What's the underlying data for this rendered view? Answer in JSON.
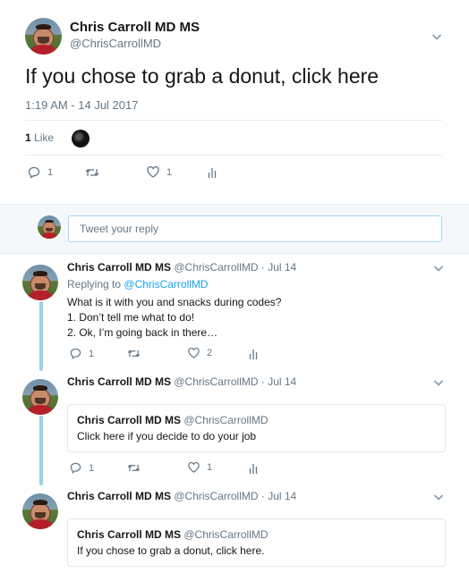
{
  "main_tweet": {
    "display_name": "Chris Carroll MD MS",
    "handle": "@ChrisCarrollMD",
    "text": "If you chose to grab a donut, click here",
    "timestamp": "1:19 AM - 14 Jul 2017",
    "like_count": "1",
    "like_label": "Like",
    "actions": {
      "replies": "1",
      "retweets": "",
      "likes": "1"
    }
  },
  "composer": {
    "placeholder": "Tweet your reply"
  },
  "replies": [
    {
      "display_name": "Chris Carroll MD MS",
      "handle_date": "@ChrisCarrollMD · Jul 14",
      "replying_prefix": "Replying to",
      "replying_to": "@ChrisCarrollMD",
      "lines": [
        "What is it with you and snacks during codes?",
        "1. Don’t tell me what to do!",
        "2. Ok, I’m going back in there…"
      ],
      "actions": {
        "replies": "1",
        "retweets": "",
        "likes": "2"
      }
    },
    {
      "display_name": "Chris Carroll MD MS",
      "handle_date": "@ChrisCarrollMD · Jul 14",
      "quote": {
        "display_name": "Chris Carroll MD MS",
        "handle": "@ChrisCarrollMD",
        "text": "Click here if you decide to do your job"
      },
      "actions": {
        "replies": "1",
        "retweets": "",
        "likes": "1"
      }
    },
    {
      "display_name": "Chris Carroll MD MS",
      "handle_date": "@ChrisCarrollMD · Jul 14",
      "quote": {
        "display_name": "Chris Carroll MD MS",
        "handle": "@ChrisCarrollMD",
        "text": "If you chose to grab a donut, click here."
      }
    }
  ],
  "colors": {
    "accent": "#1da1f2",
    "thread_line": "#99d3e6",
    "muted": "#657786"
  }
}
